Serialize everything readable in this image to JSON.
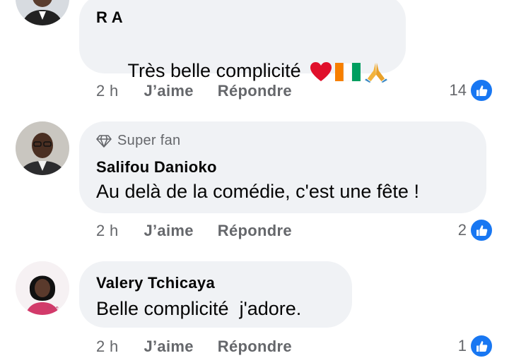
{
  "comments": [
    {
      "author": "R A",
      "text": "Très belle complicité",
      "emojis": [
        "red-heart",
        "ivory-coast-flag",
        "folded-hands"
      ],
      "time": "2 h",
      "like_label": "J’aime",
      "reply_label": "Répondre",
      "reactions": "14",
      "badge": ""
    },
    {
      "author": "Salifou Danioko",
      "text": "Au delà de la comédie, c'est une fête !",
      "time": "2 h",
      "like_label": "J’aime",
      "reply_label": "Répondre",
      "reactions": "2",
      "badge": "Super fan"
    },
    {
      "author": "Valery Tchicaya",
      "text": "Belle complicité  j'adore.",
      "time": "2 h",
      "like_label": "J’aime",
      "reply_label": "Répondre",
      "reactions": "1",
      "badge": ""
    }
  ],
  "colors": {
    "bubble": "#f0f2f5",
    "secondary_text": "#65676b",
    "like_blue": "#1877f2"
  }
}
